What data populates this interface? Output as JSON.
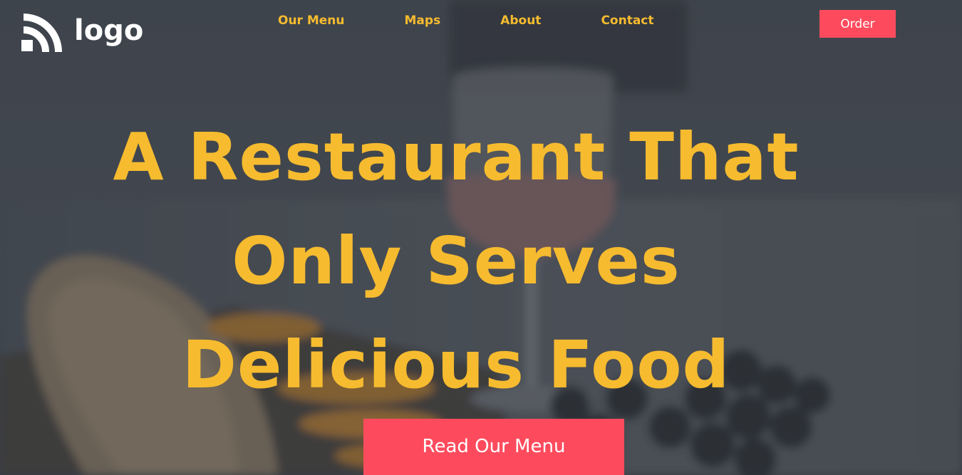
{
  "header": {
    "logo_text": "logo",
    "logo_icon": "wifi-arcs-icon",
    "nav": [
      {
        "label": "Our Menu"
      },
      {
        "label": "Maps"
      },
      {
        "label": "About"
      },
      {
        "label": "Contact"
      }
    ],
    "order_label": "Order"
  },
  "hero": {
    "headline_lines": [
      "A Restaurant That",
      "Only Serves",
      "Delicious Food"
    ],
    "cta_label": "Read Our Menu"
  },
  "colors": {
    "accent_yellow": "#f6bb2f",
    "button_red": "#fd4b5d",
    "overlay": "#3f454d"
  }
}
